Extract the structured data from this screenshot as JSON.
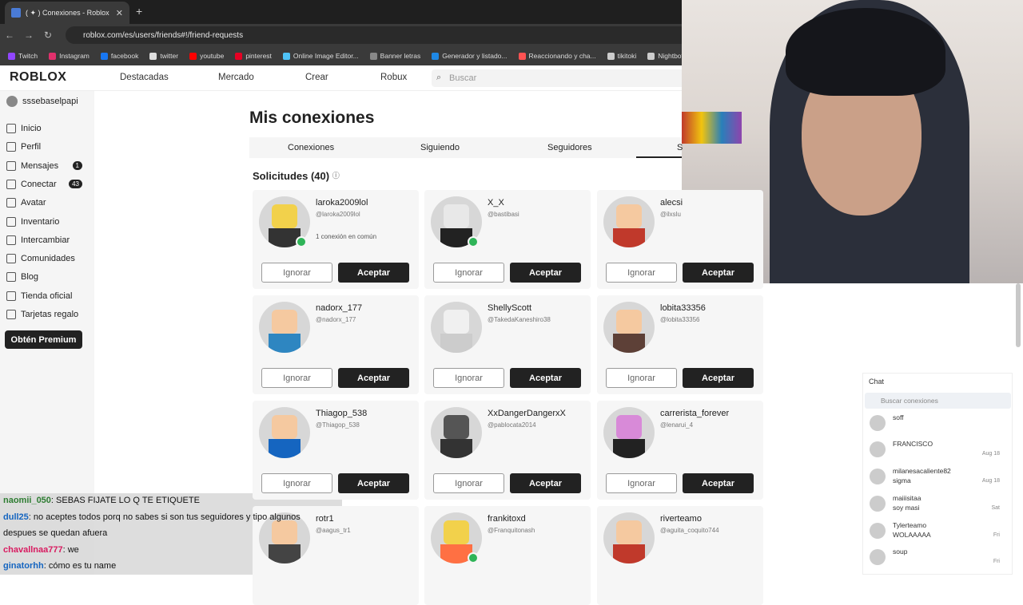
{
  "browser": {
    "tab_title": "( ✦ ) Conexiones - Roblox",
    "new_tab": "+",
    "close_tab": "✕",
    "url": "roblox.com/es/users/friends#!/friend-requests",
    "bookmarks": [
      {
        "label": "Twitch",
        "color": "#9146ff"
      },
      {
        "label": "Instagram",
        "color": "#e1306c"
      },
      {
        "label": "facebook",
        "color": "#1877f2"
      },
      {
        "label": "twitter",
        "color": "#dddddd"
      },
      {
        "label": "youtube",
        "color": "#ff0000"
      },
      {
        "label": "pinterest",
        "color": "#e60023"
      },
      {
        "label": "Online Image Editor...",
        "color": "#4fc3f7"
      },
      {
        "label": "Banner letras",
        "color": "#888888"
      },
      {
        "label": "Generador y listado...",
        "color": "#1e88e5"
      },
      {
        "label": "Reaccionando y cha...",
        "color": "#ff5252"
      },
      {
        "label": "tikitoki",
        "color": "#cccccc"
      },
      {
        "label": "Nightbot - C",
        "color": "#cccccc"
      }
    ]
  },
  "header": {
    "logo": "ROBLOX",
    "nav": [
      "Destacadas",
      "Mercado",
      "Crear",
      "Robux"
    ],
    "search_placeholder": "Buscar"
  },
  "sidebar": {
    "username": "sssebaselpapi",
    "items": [
      {
        "label": "Inicio",
        "badge": ""
      },
      {
        "label": "Perfil",
        "badge": ""
      },
      {
        "label": "Mensajes",
        "badge": "1"
      },
      {
        "label": "Conectar",
        "badge": "43"
      },
      {
        "label": "Avatar",
        "badge": ""
      },
      {
        "label": "Inventario",
        "badge": ""
      },
      {
        "label": "Intercambiar",
        "badge": ""
      },
      {
        "label": "Comunidades",
        "badge": ""
      },
      {
        "label": "Blog",
        "badge": ""
      },
      {
        "label": "Tienda oficial",
        "badge": ""
      },
      {
        "label": "Tarjetas regalo",
        "badge": ""
      }
    ],
    "premium": "Obtén Premium"
  },
  "main": {
    "title": "Mis conexiones",
    "tabs": [
      "Conexiones",
      "Siguiendo",
      "Seguidores",
      "S"
    ],
    "requests_title": "Solicitudes (40)",
    "ignore_label": "Ignorar",
    "accept_label": "Aceptar",
    "cards": [
      {
        "name": "laroka2009lol",
        "handle": "@laroka2009lol",
        "mutual": "1 conexión en común",
        "skin": "#f2d14b",
        "shirt": "#333",
        "game": true
      },
      {
        "name": "X_X",
        "handle": "@bastibasi",
        "mutual": "",
        "skin": "#e8e8e8",
        "shirt": "#222",
        "game": true
      },
      {
        "name": "alecsi",
        "handle": "@ilxslu",
        "mutual": "",
        "skin": "#f5c9a0",
        "shirt": "#c0392b",
        "game": false
      },
      {
        "name": "nadorx_177",
        "handle": "@nadorx_177",
        "mutual": "",
        "skin": "#f5c9a0",
        "shirt": "#2e86c1",
        "game": false
      },
      {
        "name": "ShellyScott",
        "handle": "@TakedaKaneshiro38",
        "mutual": "",
        "skin": "#f0f0f0",
        "shirt": "#ccc",
        "game": false
      },
      {
        "name": "lobita33356",
        "handle": "@lobita33356",
        "mutual": "",
        "skin": "#f5c9a0",
        "shirt": "#5d4037",
        "game": false
      },
      {
        "name": "Thiagop_538",
        "handle": "@Thiagop_538",
        "mutual": "",
        "skin": "#f5c9a0",
        "shirt": "#1565c0",
        "game": false
      },
      {
        "name": "XxDangerDangerxX",
        "handle": "@pablocata2014",
        "mutual": "",
        "skin": "#555",
        "shirt": "#333",
        "game": false
      },
      {
        "name": "carrerista_forever",
        "handle": "@lenarui_4",
        "mutual": "",
        "skin": "#d88ad8",
        "shirt": "#222",
        "game": false
      },
      {
        "name": "rotr1",
        "handle": "@aagus_tr1",
        "mutual": "",
        "skin": "#f5c9a0",
        "shirt": "#444",
        "game": false
      },
      {
        "name": "frankitoxd",
        "handle": "@Franquitonash",
        "mutual": "",
        "skin": "#f2d14b",
        "shirt": "#ff7043",
        "game": true
      },
      {
        "name": "riverteamo",
        "handle": "@aguita_coquito744",
        "mutual": "",
        "skin": "#f5c9a0",
        "shirt": "#c0392b",
        "game": false
      }
    ]
  },
  "chat": {
    "title": "Chat",
    "search_placeholder": "Buscar conexiones",
    "rows": [
      {
        "name": "soff",
        "msg": "",
        "time": ""
      },
      {
        "name": "FRANCISCO",
        "msg": "",
        "time": "Aug 18"
      },
      {
        "name": "milanesacaliente82",
        "msg": "sigma",
        "time": "Aug 18"
      },
      {
        "name": "maiiisitaa",
        "msg": "soy masi",
        "time": "Sat"
      },
      {
        "name": "Tylerteamo",
        "msg": "WOLAAAAA",
        "time": "Fri"
      },
      {
        "name": "soup",
        "msg": "",
        "time": "Fri"
      }
    ]
  },
  "stream_chat": [
    {
      "user": "naomii_050",
      "msg": ": SEBAS FIJATE LO Q TE ETIQUETE",
      "color": "#2e7d32"
    },
    {
      "user": "dull25",
      "msg": ": no aceptes todos porq no sabes si son tus seguidores y tipo algunos",
      "color": "#1565c0"
    },
    {
      "user": "",
      "msg": "despues se quedan afuera",
      "color": "#111"
    },
    {
      "user": "chavallnaa777",
      "msg": ": we",
      "color": "#d81b60"
    },
    {
      "user": "ginatorhh",
      "msg": ": cómo es tu name",
      "color": "#1565c0"
    }
  ]
}
